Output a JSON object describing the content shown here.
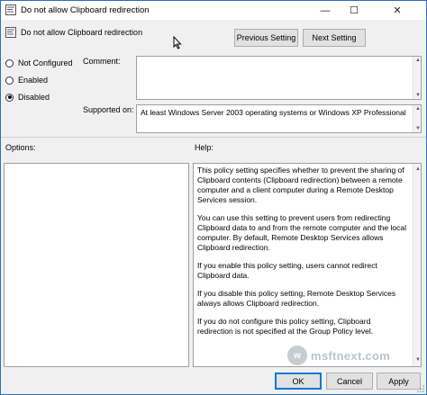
{
  "window": {
    "title": "Do not allow Clipboard redirection",
    "minimize": "—",
    "maximize": "☐",
    "close": "✕"
  },
  "header": {
    "policy_name": "Do not allow Clipboard redirection",
    "prev_label": "Previous Setting",
    "next_label": "Next Setting"
  },
  "state": {
    "options": [
      {
        "label": "Not Configured",
        "selected": false
      },
      {
        "label": "Enabled",
        "selected": false
      },
      {
        "label": "Disabled",
        "selected": true
      }
    ]
  },
  "comment": {
    "label": "Comment:",
    "value": ""
  },
  "supported": {
    "label": "Supported on:",
    "value": "At least Windows Server 2003 operating systems or Windows XP Professional"
  },
  "panes": {
    "options_label": "Options:",
    "help_label": "Help:",
    "help_paragraphs": [
      "This policy setting specifies whether to prevent the sharing of Clipboard contents (Clipboard redirection) between a remote computer and a client computer during a Remote Desktop Services session.",
      "You can use this setting to prevent users from redirecting Clipboard data to and from the remote computer and the local computer. By default, Remote Desktop Services allows Clipboard redirection.",
      "If you enable this policy setting, users cannot redirect Clipboard data.",
      "If you disable this policy setting, Remote Desktop Services always allows Clipboard redirection.",
      "If you do not configure this policy setting, Clipboard redirection is not specified at the Group Policy level."
    ]
  },
  "footer": {
    "ok": "OK",
    "cancel": "Cancel",
    "apply": "Apply"
  },
  "watermark": {
    "text": "msftnext.com",
    "mark": "w"
  }
}
